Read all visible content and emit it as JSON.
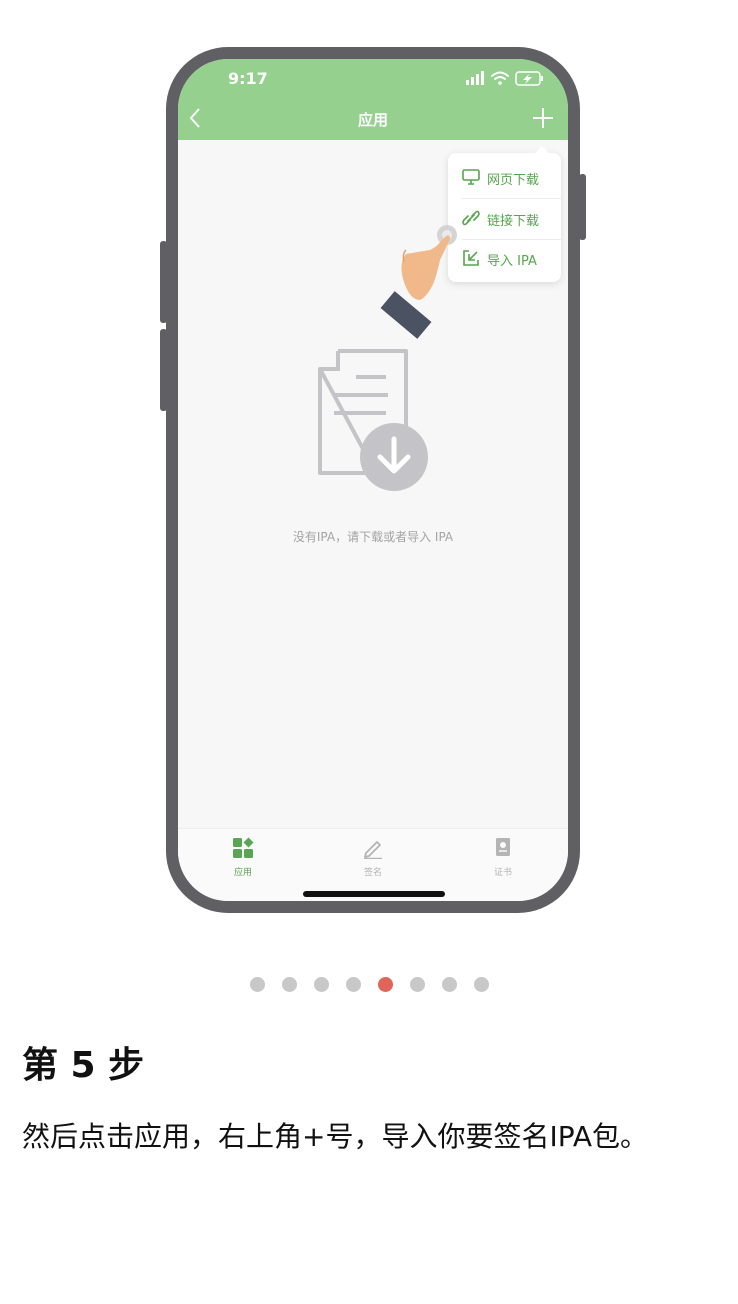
{
  "phone": {
    "status_time": "9:17",
    "nav_title": "应用",
    "menu": [
      {
        "label": "网页下载",
        "icon": "monitor-icon"
      },
      {
        "label": "链接下载",
        "icon": "link-icon"
      },
      {
        "label": "导入 IPA",
        "icon": "import-icon"
      }
    ],
    "empty_message": "没有IPA，请下载或者导入 IPA",
    "tabs": [
      {
        "label": "应用",
        "icon": "apps-grid-icon",
        "active": true
      },
      {
        "label": "签名",
        "icon": "pen-icon",
        "active": false
      },
      {
        "label": "证书",
        "icon": "certificate-icon",
        "active": false
      }
    ]
  },
  "pagination": {
    "total": 8,
    "current": 5
  },
  "step": {
    "title": "第 5 步",
    "description": "然后点击应用，右上角+号，导入你要签名IPA包。"
  },
  "colors": {
    "header": "#95d08f",
    "accent": "#55a64d",
    "active_dot": "#e0645a"
  }
}
